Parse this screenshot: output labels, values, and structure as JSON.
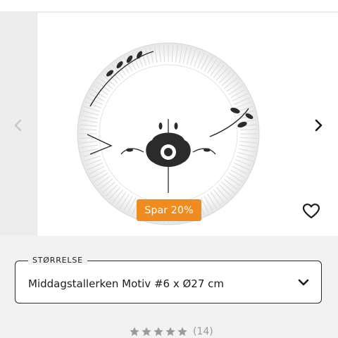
{
  "product": {
    "image": "plate-image",
    "sale_badge": "Spar 20%"
  },
  "gallery": {
    "prev_icon": "chevron-left-icon",
    "next_icon": "chevron-right-icon",
    "wishlist_icon": "heart-icon"
  },
  "size_selector": {
    "label": "STØRRELSE",
    "selected": "Middagstallerken Motiv #6 x Ø27 cm",
    "chevron_icon": "chevron-down-icon"
  },
  "rating": {
    "stars": 5,
    "count": "(14)"
  },
  "colors": {
    "sale": "#f08c1f",
    "star": "#9a9a9a"
  }
}
